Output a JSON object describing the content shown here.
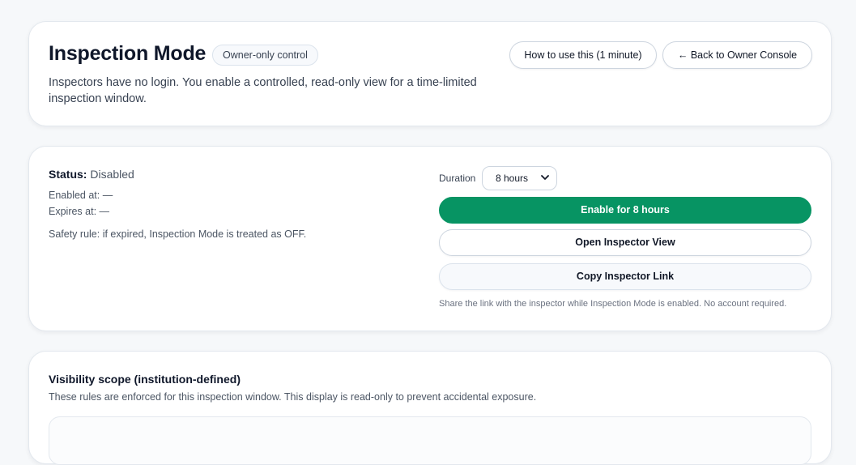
{
  "header": {
    "title": "Inspection Mode",
    "badge": "Owner-only control",
    "subtitle": "Inspectors have no login. You enable a controlled, read-only view for a time-limited inspection window.",
    "how_to_label": "How to use this (1 minute)",
    "back_label": "← Back to Owner Console"
  },
  "status": {
    "label": "Status:",
    "value": "Disabled",
    "enabled_at": "Enabled at: —",
    "expires_at": "Expires at: —",
    "safety_rule": "Safety rule: if expired, Inspection Mode is treated as OFF."
  },
  "controls": {
    "duration_label": "Duration",
    "duration_selected": "8 hours",
    "enable_label": "Enable for 8 hours",
    "open_label": "Open Inspector View",
    "copy_label": "Copy Inspector Link",
    "share_note": "Share the link with the inspector while Inspection Mode is enabled. No account required."
  },
  "scope": {
    "title": "Visibility scope (institution-defined)",
    "description": "These rules are enforced for this inspection window. This display is read-only to prevent accidental exposure."
  },
  "colors": {
    "accent_green": "#079463",
    "background": "#f6f8fa"
  }
}
